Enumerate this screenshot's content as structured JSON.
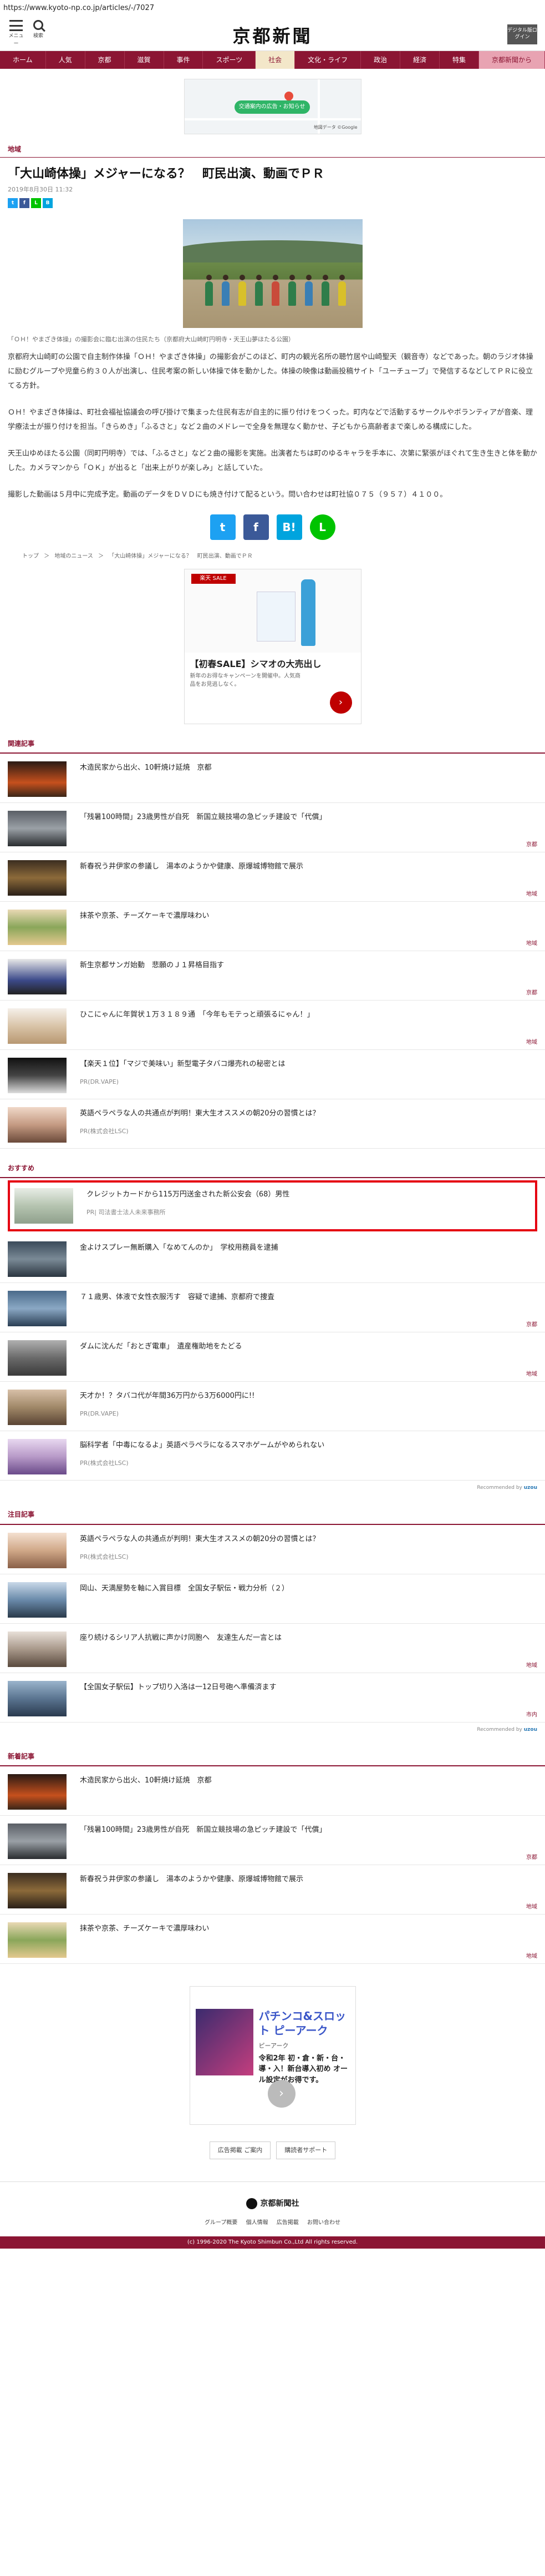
{
  "url": "https://www.kyoto-np.co.jp/articles/-/7027",
  "header": {
    "menu_label": "メニュー",
    "search_label": "検索",
    "logo": "京都新聞",
    "digital_label": "デジタル版ログイン"
  },
  "nav": [
    "ホーム",
    "人気",
    "京都",
    "滋賀",
    "事件",
    "スポーツ",
    "社会",
    "文化・ライフ",
    "政治",
    "経済",
    "特集",
    "京都新聞から"
  ],
  "ad_top": {
    "pill": "交通案内の広告・お知らせ",
    "note": "地図データ ©Google"
  },
  "article": {
    "section": "地域",
    "title": "「大山崎体操」メジャーになる？　町民出演、動画でＰＲ",
    "date": "2019年8月30日 11:32",
    "caption": "「ＯＨ！やまざき体操」の撮影会に臨む出演の住民たち（京都府大山崎町円明寺・天王山夢ほたる公園）",
    "paragraphs": [
      "京都府大山崎町の公園で自主制作体操「ＯＨ！やまざき体操」の撮影会がこのほど、町内の観光名所の聴竹居や山崎聖天（観音寺）などであった。朝のラジオ体操に励むグループや児童ら約３０人が出演し、住民考案の新しい体操で体を動かした。体操の映像は動画投稿サイト「ユーチューブ」で発信するなどしてＰＲに役立てる方針。",
      "ＯＨ！やまざき体操は、町社会福祉協議会の呼び掛けで集まった住民有志が自主的に振り付けをつくった。町内などで活動するサークルやボランティアが音楽、理学療法士が振り付けを担当。「きらめき」「ふるさと」など２曲のメドレーで全身を無理なく動かせ、子どもから高齢者まで楽しめる構成にした。",
      "天王山ゆめほたる公園（同町円明寺）では、「ふるさと」など２曲の撮影を実施。出演者たちは町のゆるキャラを手本に、次第に緊張がほぐれて生き生きと体を動かした。カメラマンから「ＯＫ」が出ると「出来上がりが楽しみ」と話していた。",
      "撮影した動画は５月中に完成予定。動画のデータをＤＶＤにも焼き付けて配るという。問い合わせは町社協０７５（９５７）４１００。"
    ]
  },
  "breadcrumb": [
    "トップ",
    "＞",
    "地域のニュース",
    "＞",
    "「大山崎体操」メジャーになる？　町民出演、動画でＰＲ"
  ],
  "ad_mid": {
    "badge": "楽天 SALE",
    "title": "【初春SALE】シマオの大売出し",
    "desc": "新年のお得なキャンペーンを開催中。人気商品をお見逃しなく。"
  },
  "related": {
    "heading": "関連記事",
    "items": [
      {
        "title": "木造民家から出火、10軒焼け延焼　京都",
        "tag": ""
      },
      {
        "title": "「残暑100時間」23歳男性が自死　新国立競技場の急ピッチ建設で「代償」",
        "tag": "京都"
      },
      {
        "title": "新春祝う井伊家の参議し　湯本のようかや健康、原爆城博物館で展示",
        "tag": "地域"
      },
      {
        "title": "抹茶や京茶、チーズケーキで濃厚味わい",
        "tag": "地域"
      },
      {
        "title": "新生京都サンガ始動　悲願のＪ１昇格目指す",
        "tag": "京都"
      },
      {
        "title": "ひこにゃんに年賀状１万３１８９通　「今年もモテっと頑張るにゃん！」",
        "tag": "地域"
      },
      {
        "title": "【楽天１位】「マジで美味い」新型電子タバコ爆売れの秘密とは",
        "pr": "PR(DR.VAPE)"
      },
      {
        "title": "英語ペラペラな人の共通点が判明！東大生オススメの朝20分の習慣とは？",
        "pr": "PR(株式会社LSC)"
      }
    ]
  },
  "recommend": {
    "heading": "おすすめ",
    "items": [
      {
        "title": "クレジットカードから115万円送金された新公安会（68）男性",
        "pr": "PR| 司法書士法人未来事務所",
        "highlight": true
      },
      {
        "title": "金よけスプレー無断購入「なめてんのか」　学校用務員を逮捕",
        "tag": ""
      },
      {
        "title": "７１歳男、体液で女性衣服汚す　容疑で逮捕、京都府で捜査",
        "tag": "京都"
      },
      {
        "title": "ダムに沈んだ「おとぎ電車」　遺産権助地をたどる",
        "tag": "地域"
      },
      {
        "title": "天才か！？タバコ代が年間36万円から3万6000円に!!",
        "pr": "PR(DR.VAPE)"
      },
      {
        "title": "脳科学者「中毒になるよ」英語ペラペラになるスマホゲームがやめられない",
        "pr": "PR(株式会社LSC)"
      }
    ],
    "recommended_by": "Recommended by",
    "brand": "uzou"
  },
  "attention": {
    "heading": "注目記事",
    "items": [
      {
        "title": "英語ペラペラな人の共通点が判明！東大生オススメの朝20分の習慣とは？",
        "pr": "PR(株式会社LSC)"
      },
      {
        "title": "岡山、天満屋勢を軸に入賞目標　全国女子駅伝・戦力分析（２）",
        "tag": ""
      },
      {
        "title": "座り続けるシリア人抗戦に声かけ同胞へ　友達生んだ一言とは",
        "tag": "地域"
      },
      {
        "title": "【全国女子駅伝】トップ切り入洛は一12日号砲へ準備済ます",
        "tag": "市内"
      }
    ],
    "recommended_by": "Recommended by",
    "brand": "uzou"
  },
  "latest": {
    "heading": "新着記事",
    "items": [
      {
        "title": "木造民家から出火、10軒焼け延焼　京都",
        "tag": ""
      },
      {
        "title": "「残暑100時間」23歳男性が自死　新国立競技場の急ピッチ建設で「代償」",
        "tag": "京都"
      },
      {
        "title": "新春祝う井伊家の参議し　湯本のようかや健康、原爆城博物館で展示",
        "tag": "地域"
      },
      {
        "title": "抹茶や京茶、チーズケーキで濃厚味わい",
        "tag": "地域"
      }
    ]
  },
  "ad_bottom": {
    "headline": "パチンコ&スロット ピーアーク",
    "sub": "ピーアーク",
    "desc": "令和2年 初・倉・新・台・導・入！新台導入初め オール設定がお得です。"
  },
  "links": [
    "広告掲載 ご案内",
    "購読者サポート"
  ],
  "footer": {
    "brand": "京都新聞社",
    "links": [
      "グループ概要",
      "個人情報",
      "広告掲載",
      "お問い合わせ"
    ],
    "copyright": "(c) 1996-2020 The Kyoto Shimbun Co.,Ltd All rights reserved."
  },
  "colors": {
    "brand": "#8b1533",
    "highlight": "#e50012",
    "twitter": "#1da1f2",
    "facebook": "#3b5998",
    "hatena": "#00a4de",
    "line": "#00c300"
  }
}
